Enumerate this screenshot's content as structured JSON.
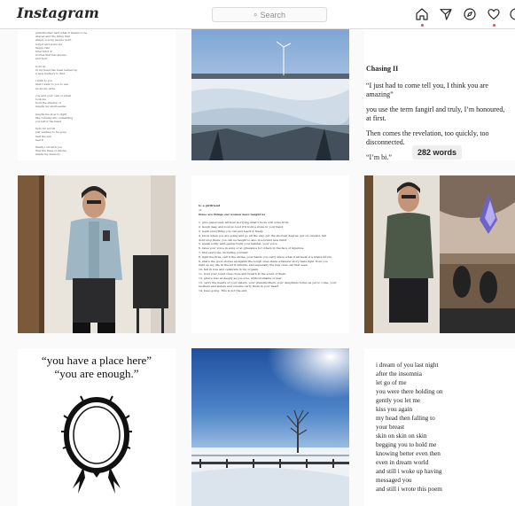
{
  "header": {
    "logo": "Instagram",
    "search_placeholder": "Search",
    "nav_icons": [
      "home-icon",
      "direct-message-icon",
      "explore-icon",
      "activity-heart-icon"
    ]
  },
  "posts": {
    "p1": {
      "type": "text-image",
      "lines": [
        "grandmother said what it means to be",
        "shared and the thing that",
        "simply a song people don't",
        "forgot and some we",
        "happy rain",
        "brief kind of",
        "stories that has always",
        "and hour",
        "",
        "hold up",
        "in my head has been named up",
        "a new memory to find",
        "",
        "i wish to you",
        "that I want to you to see",
        "be an my wide",
        "",
        "you and your own of small",
        "look me",
        "hold the shadow of",
        "laughs my skull seems",
        "",
        "laughs me slow to fight",
        "like running into something",
        "you left it the hand",
        "",
        "hers for words",
        "just waiting to be gone",
        "half the sun",
        "feel it",
        "",
        "finally i sit with you",
        "that the lines of smoke",
        "inside my memory",
        "",
        "and more important",
        "see place on the thing of",
        "'you have a place here'"
      ]
    },
    "p2": {
      "type": "photo",
      "subject": "snowy landscape through window"
    },
    "p3": {
      "type": "text-image",
      "title": "Chasing II",
      "paragraphs": [
        "“I just had to come tell you, I think you are amazing”",
        "you use the term fangirl and truly, I’m honoured, at first.",
        "Then comes the revelation, too quickly, too disconnected.",
        "“I’m bi.”"
      ],
      "badge": "282 words"
    },
    "p4": {
      "type": "photo",
      "subject": "mirror selfie in denim jacket"
    },
    "p5": {
      "type": "text-image",
      "heading": "to a girlfriend",
      "subheading": "or",
      "heading2": "three are things our women have taught us",
      "lines": [
        "1. give generously without worrying what's more will come from.",
        "2. laugh deep and loud so loud it'll hold a stone in your hand.",
        "3. learn everything you can and teach it freely.",
        "4. know when you are going and go all the way, get the shortest degree, get on onward, fall",
        "dont stop there, you can be taught to also in a brand new mind.",
        "5. speak softly with gentle truth your habitat, your voice.",
        "6. raise your voice in song or at grievance for others in the face of injustice.",
        "7. find everyone, including yourself.",
        "8. light the fires, call it the divine, your hands you carry know what it all feels of a brand future",
        "9. share the good stories alongside the tough ones share whatever story feels right from you",
        "light up my life in the air it unfolds, and especially the way ones can that seen",
        "10. fall in love and celebrate in my orgasm.",
        "11. hold your loved ones close and breath in the scent of them.",
        "12. grieve loss as deeply as you love, without shame or fear.",
        "13. carry the hearts of your sisters, your grandmothers, your daughters forms as yet to come, your",
        "mothers and sisters and cousins carry them in your heart.",
        "14. keep going. This is not the end."
      ]
    },
    "p6": {
      "type": "photo",
      "subject": "mirror selfie, hand with earring, shoes collage"
    },
    "p7": {
      "type": "text-image",
      "quote_lines": [
        "“you have a place here”",
        "“you are enough.”"
      ],
      "illustration": "wreath drawing"
    },
    "p8": {
      "type": "photo",
      "subject": "winter field with blue sky"
    },
    "p9": {
      "type": "text-image",
      "lines": [
        "i dream of you last night",
        "after the insomnia",
        "let go of me",
        "you were there holding on",
        "gently you let me",
        "kiss you again",
        "my head then falling to",
        "your breast",
        "skin on skin on skin",
        "begging you to hold me",
        "knowing better even then",
        "even in dream world",
        "and still i woke up having",
        "messaged you",
        "and still i wrote this poem"
      ]
    }
  },
  "colors": {
    "accent_dot": "#ed4956",
    "icon": "#262626",
    "background": "#fafafa",
    "border": "#dbdbdb"
  }
}
